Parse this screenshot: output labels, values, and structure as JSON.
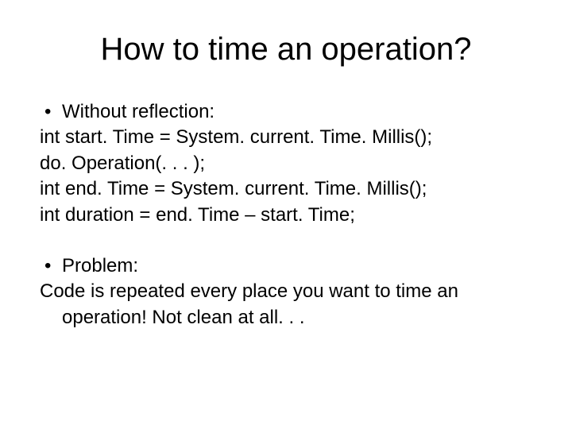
{
  "title": "How to time an operation?",
  "section1": {
    "bullet": "Without reflection:",
    "lines": [
      "int start. Time = System. current. Time. Millis();",
      "do. Operation(. . . );",
      "int end. Time = System. current. Time. Millis();",
      "int duration = end. Time – start. Time;"
    ]
  },
  "section2": {
    "bullet": "Problem:",
    "lines": [
      "Code is repeated every place you want to time an operation!  Not clean at all. . ."
    ]
  }
}
